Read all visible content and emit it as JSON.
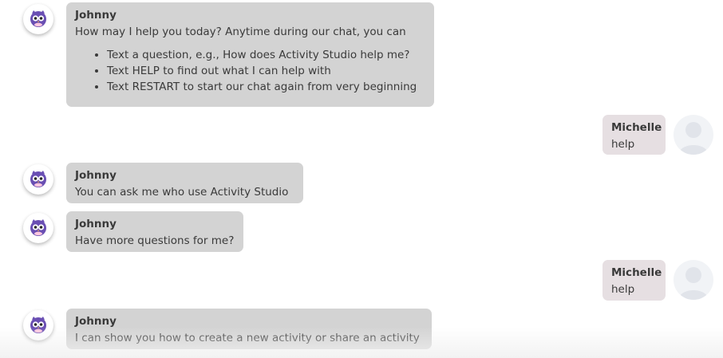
{
  "colors": {
    "bot_bubble": "#d3d3d3",
    "user_bubble": "#e6dfe2",
    "text": "#3a3a3a",
    "bot_avatar_accent": "#6a4fb3"
  },
  "messages": [
    {
      "sender": "Johnny",
      "role": "bot",
      "avatar_icon": "bot-owl-icon",
      "text": "How may I help you today? Anytime during our chat, you can",
      "list": [
        "Text a question, e.g., How does Activity Studio help me?",
        "Text HELP to find out what I can help with",
        "Text RESTART to start our chat again from very beginning"
      ]
    },
    {
      "sender": "Michelle",
      "role": "user",
      "avatar_icon": "user-placeholder-icon",
      "text": "help"
    },
    {
      "sender": "Johnny",
      "role": "bot",
      "avatar_icon": "bot-owl-icon",
      "text": "You can ask me who use Activity Studio"
    },
    {
      "sender": "Johnny",
      "role": "bot",
      "avatar_icon": "bot-owl-icon",
      "text": "Have more questions for me?"
    },
    {
      "sender": "Michelle",
      "role": "user",
      "avatar_icon": "user-placeholder-icon",
      "text": "help"
    },
    {
      "sender": "Johnny",
      "role": "bot",
      "avatar_icon": "bot-owl-icon",
      "text": "I can show you how to create a new activity or share an activity"
    }
  ]
}
